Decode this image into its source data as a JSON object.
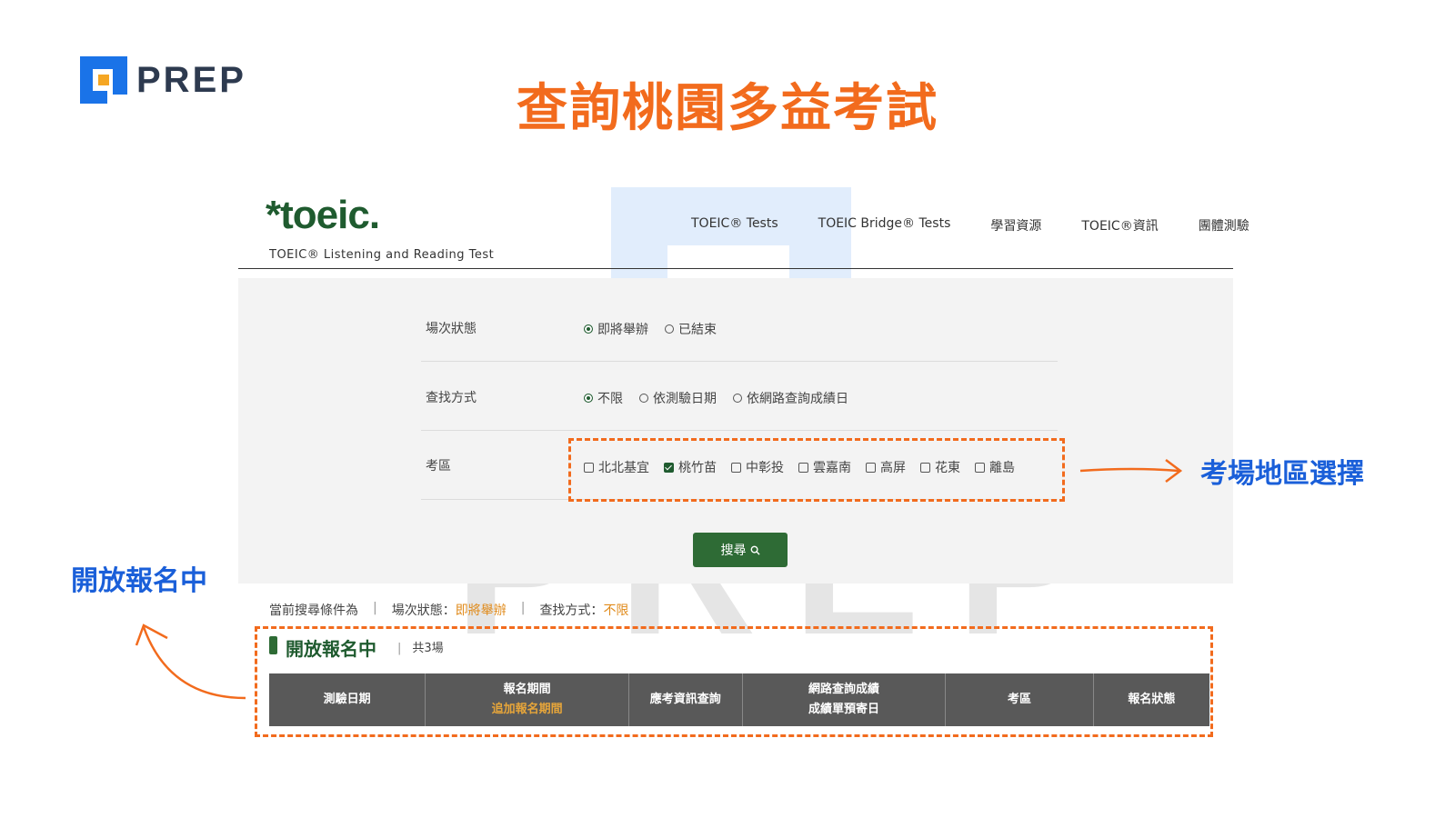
{
  "brand": {
    "name": "PREP",
    "color": "#2d3a4f",
    "logo_colors": [
      "#1a73e8",
      "#f5a623"
    ]
  },
  "title": "查詢桃園多益考試",
  "watermark": "PREP",
  "site": {
    "logo": "*toeic.",
    "subtitle": "TOEIC® Listening and Reading Test",
    "nav": [
      "TOEIC® Tests",
      "TOEIC Bridge® Tests",
      "學習資源",
      "TOEIC®資訊",
      "團體測驗"
    ]
  },
  "filters": {
    "status": {
      "label": "場次狀態",
      "options": [
        {
          "text": "即將舉辦",
          "selected": true
        },
        {
          "text": "已結束",
          "selected": false
        }
      ]
    },
    "method": {
      "label": "查找方式",
      "options": [
        {
          "text": "不限",
          "selected": true
        },
        {
          "text": "依測驗日期",
          "selected": false
        },
        {
          "text": "依網路查詢成績日",
          "selected": false
        }
      ]
    },
    "region": {
      "label": "考區",
      "options": [
        {
          "text": "北北基宜",
          "checked": false
        },
        {
          "text": "桃竹苗",
          "checked": true
        },
        {
          "text": "中彰投",
          "checked": false
        },
        {
          "text": "雲嘉南",
          "checked": false
        },
        {
          "text": "高屏",
          "checked": false
        },
        {
          "text": "花東",
          "checked": false
        },
        {
          "text": "離島",
          "checked": false
        }
      ]
    },
    "search_button": "搜尋"
  },
  "criteria": {
    "prefix": "當前搜尋條件為",
    "status_label": "場次狀態：",
    "status_value": "即將舉辦",
    "method_label": "查找方式：",
    "method_value": "不限"
  },
  "section": {
    "title": "開放報名中",
    "count": "共3場"
  },
  "table": {
    "columns": [
      {
        "line1": "測驗日期",
        "line2": ""
      },
      {
        "line1": "報名期間",
        "line2": "追加報名期間"
      },
      {
        "line1": "應考資訊查詢",
        "line2": ""
      },
      {
        "line1": "網路查詢成績",
        "line2": "成績單預寄日"
      },
      {
        "line1": "考區",
        "line2": ""
      },
      {
        "line1": "報名狀態",
        "line2": ""
      }
    ]
  },
  "annotations": {
    "region": "考場地區選擇",
    "open": "開放報名中"
  },
  "colors": {
    "accent": "#f26b1d",
    "annotation": "#1a5fd9",
    "toeic_green": "#1f5b2f",
    "button": "#2e6b35"
  }
}
